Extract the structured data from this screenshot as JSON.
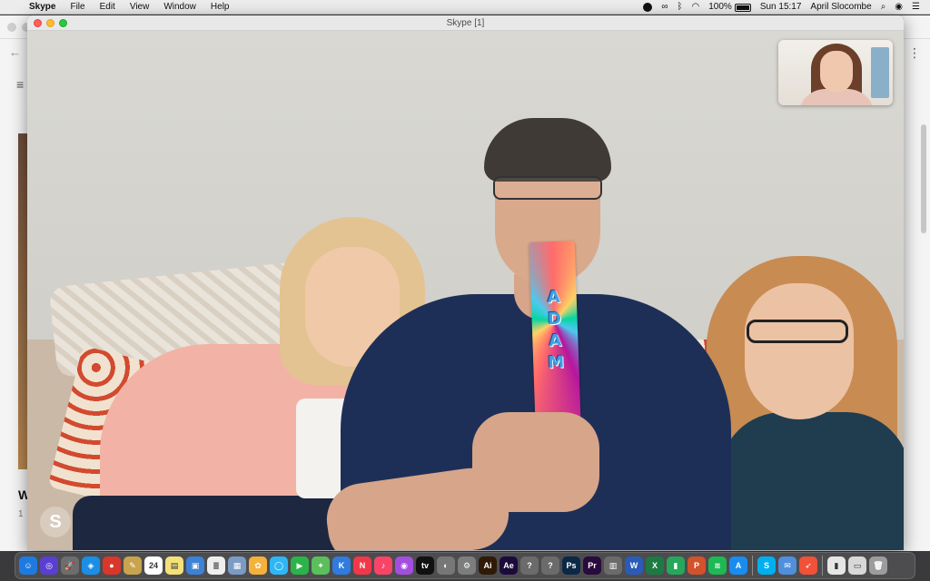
{
  "menubar": {
    "apple": "",
    "app_name": "Skype",
    "menus": [
      "File",
      "Edit",
      "View",
      "Window",
      "Help"
    ],
    "battery": "100%",
    "clock": "Sun 15:17",
    "user": "April Slocombe"
  },
  "skype": {
    "window_title": "Skype [1]",
    "bookmark_letters": [
      "A",
      "D",
      "A",
      "M"
    ],
    "logo": "S"
  },
  "background_window": {
    "nav_back": "←",
    "menu": "≡",
    "more": "⋮",
    "snippet_title": "W",
    "snippet_sub": "1"
  },
  "dock": {
    "apps": [
      {
        "name": "finder-icon",
        "glyph": "☺",
        "color": "#1f7ae0"
      },
      {
        "name": "siri-icon",
        "glyph": "◎",
        "color": "#5a3fd1"
      },
      {
        "name": "launchpad-icon",
        "glyph": "🚀",
        "color": "#6d6d6d"
      },
      {
        "name": "safari-icon",
        "glyph": "◈",
        "color": "#1b8ee6"
      },
      {
        "name": "chrome-icon",
        "glyph": "●",
        "color": "#d9372a"
      },
      {
        "name": "notes-icon",
        "glyph": "✎",
        "color": "#c9a44d"
      },
      {
        "name": "calendar-icon",
        "glyph": "24",
        "color": "#ffffff"
      },
      {
        "name": "stickies-icon",
        "glyph": "▤",
        "color": "#f5e17a"
      },
      {
        "name": "preview-icon",
        "glyph": "▣",
        "color": "#3c82d6"
      },
      {
        "name": "textedit-icon",
        "glyph": "≣",
        "color": "#eeeeee"
      },
      {
        "name": "image-capture-icon",
        "glyph": "▦",
        "color": "#7b9bc4"
      },
      {
        "name": "photos-icon",
        "glyph": "✿",
        "color": "#f4b13c"
      },
      {
        "name": "messages-icon",
        "glyph": "◯",
        "color": "#2fb7f5"
      },
      {
        "name": "facetime-icon",
        "glyph": "▶",
        "color": "#2bb44a"
      },
      {
        "name": "maps-icon",
        "glyph": "✦",
        "color": "#5bbf5b"
      },
      {
        "name": "keynote-icon",
        "glyph": "K",
        "color": "#2f7be0"
      },
      {
        "name": "news-icon",
        "glyph": "N",
        "color": "#f1384a"
      },
      {
        "name": "music-icon",
        "glyph": "♪",
        "color": "#f84466"
      },
      {
        "name": "podcasts-icon",
        "glyph": "◉",
        "color": "#a44ee0"
      },
      {
        "name": "apple-tv-icon",
        "glyph": "tv",
        "color": "#111111"
      },
      {
        "name": "screenshot-icon",
        "glyph": "◐",
        "color": "#777777"
      },
      {
        "name": "system-preferences-icon",
        "glyph": "⚙",
        "color": "#7d7d7d"
      },
      {
        "name": "illustrator-icon",
        "glyph": "Ai",
        "color": "#2e1a06"
      },
      {
        "name": "after-effects-icon",
        "glyph": "Ae",
        "color": "#1c0b3a"
      },
      {
        "name": "unknown-app-icon-1",
        "glyph": "?",
        "color": "#6b6b6b"
      },
      {
        "name": "unknown-app-icon-2",
        "glyph": "?",
        "color": "#6b6b6b"
      },
      {
        "name": "photoshop-icon",
        "glyph": "Ps",
        "color": "#0b2845"
      },
      {
        "name": "premiere-icon",
        "glyph": "Pr",
        "color": "#2a0b3d"
      },
      {
        "name": "docs-icon",
        "glyph": "▥",
        "color": "#6b6b6b"
      },
      {
        "name": "word-icon",
        "glyph": "W",
        "color": "#2b5bb8"
      },
      {
        "name": "excel-icon",
        "glyph": "X",
        "color": "#1e7a43"
      },
      {
        "name": "numbers-icon",
        "glyph": "▮",
        "color": "#26a85a"
      },
      {
        "name": "powerpoint-icon",
        "glyph": "P",
        "color": "#d2522b"
      },
      {
        "name": "spotify-icon",
        "glyph": "≋",
        "color": "#1db954"
      },
      {
        "name": "app-store-icon",
        "glyph": "A",
        "color": "#1a8cf0"
      },
      {
        "name": "skype-icon",
        "glyph": "S",
        "color": "#00aff0"
      },
      {
        "name": "mail-app-icon",
        "glyph": "✉",
        "color": "#4f8fdc"
      },
      {
        "name": "swift-icon",
        "glyph": "➶",
        "color": "#f05138"
      },
      {
        "name": "downloads-folder-icon",
        "glyph": "▮",
        "color": "#e6e6e6"
      },
      {
        "name": "documents-stack-icon",
        "glyph": "▭",
        "color": "#d8d8d8"
      },
      {
        "name": "trash-icon",
        "glyph": "🗑",
        "color": "#9c9c9c"
      }
    ]
  }
}
